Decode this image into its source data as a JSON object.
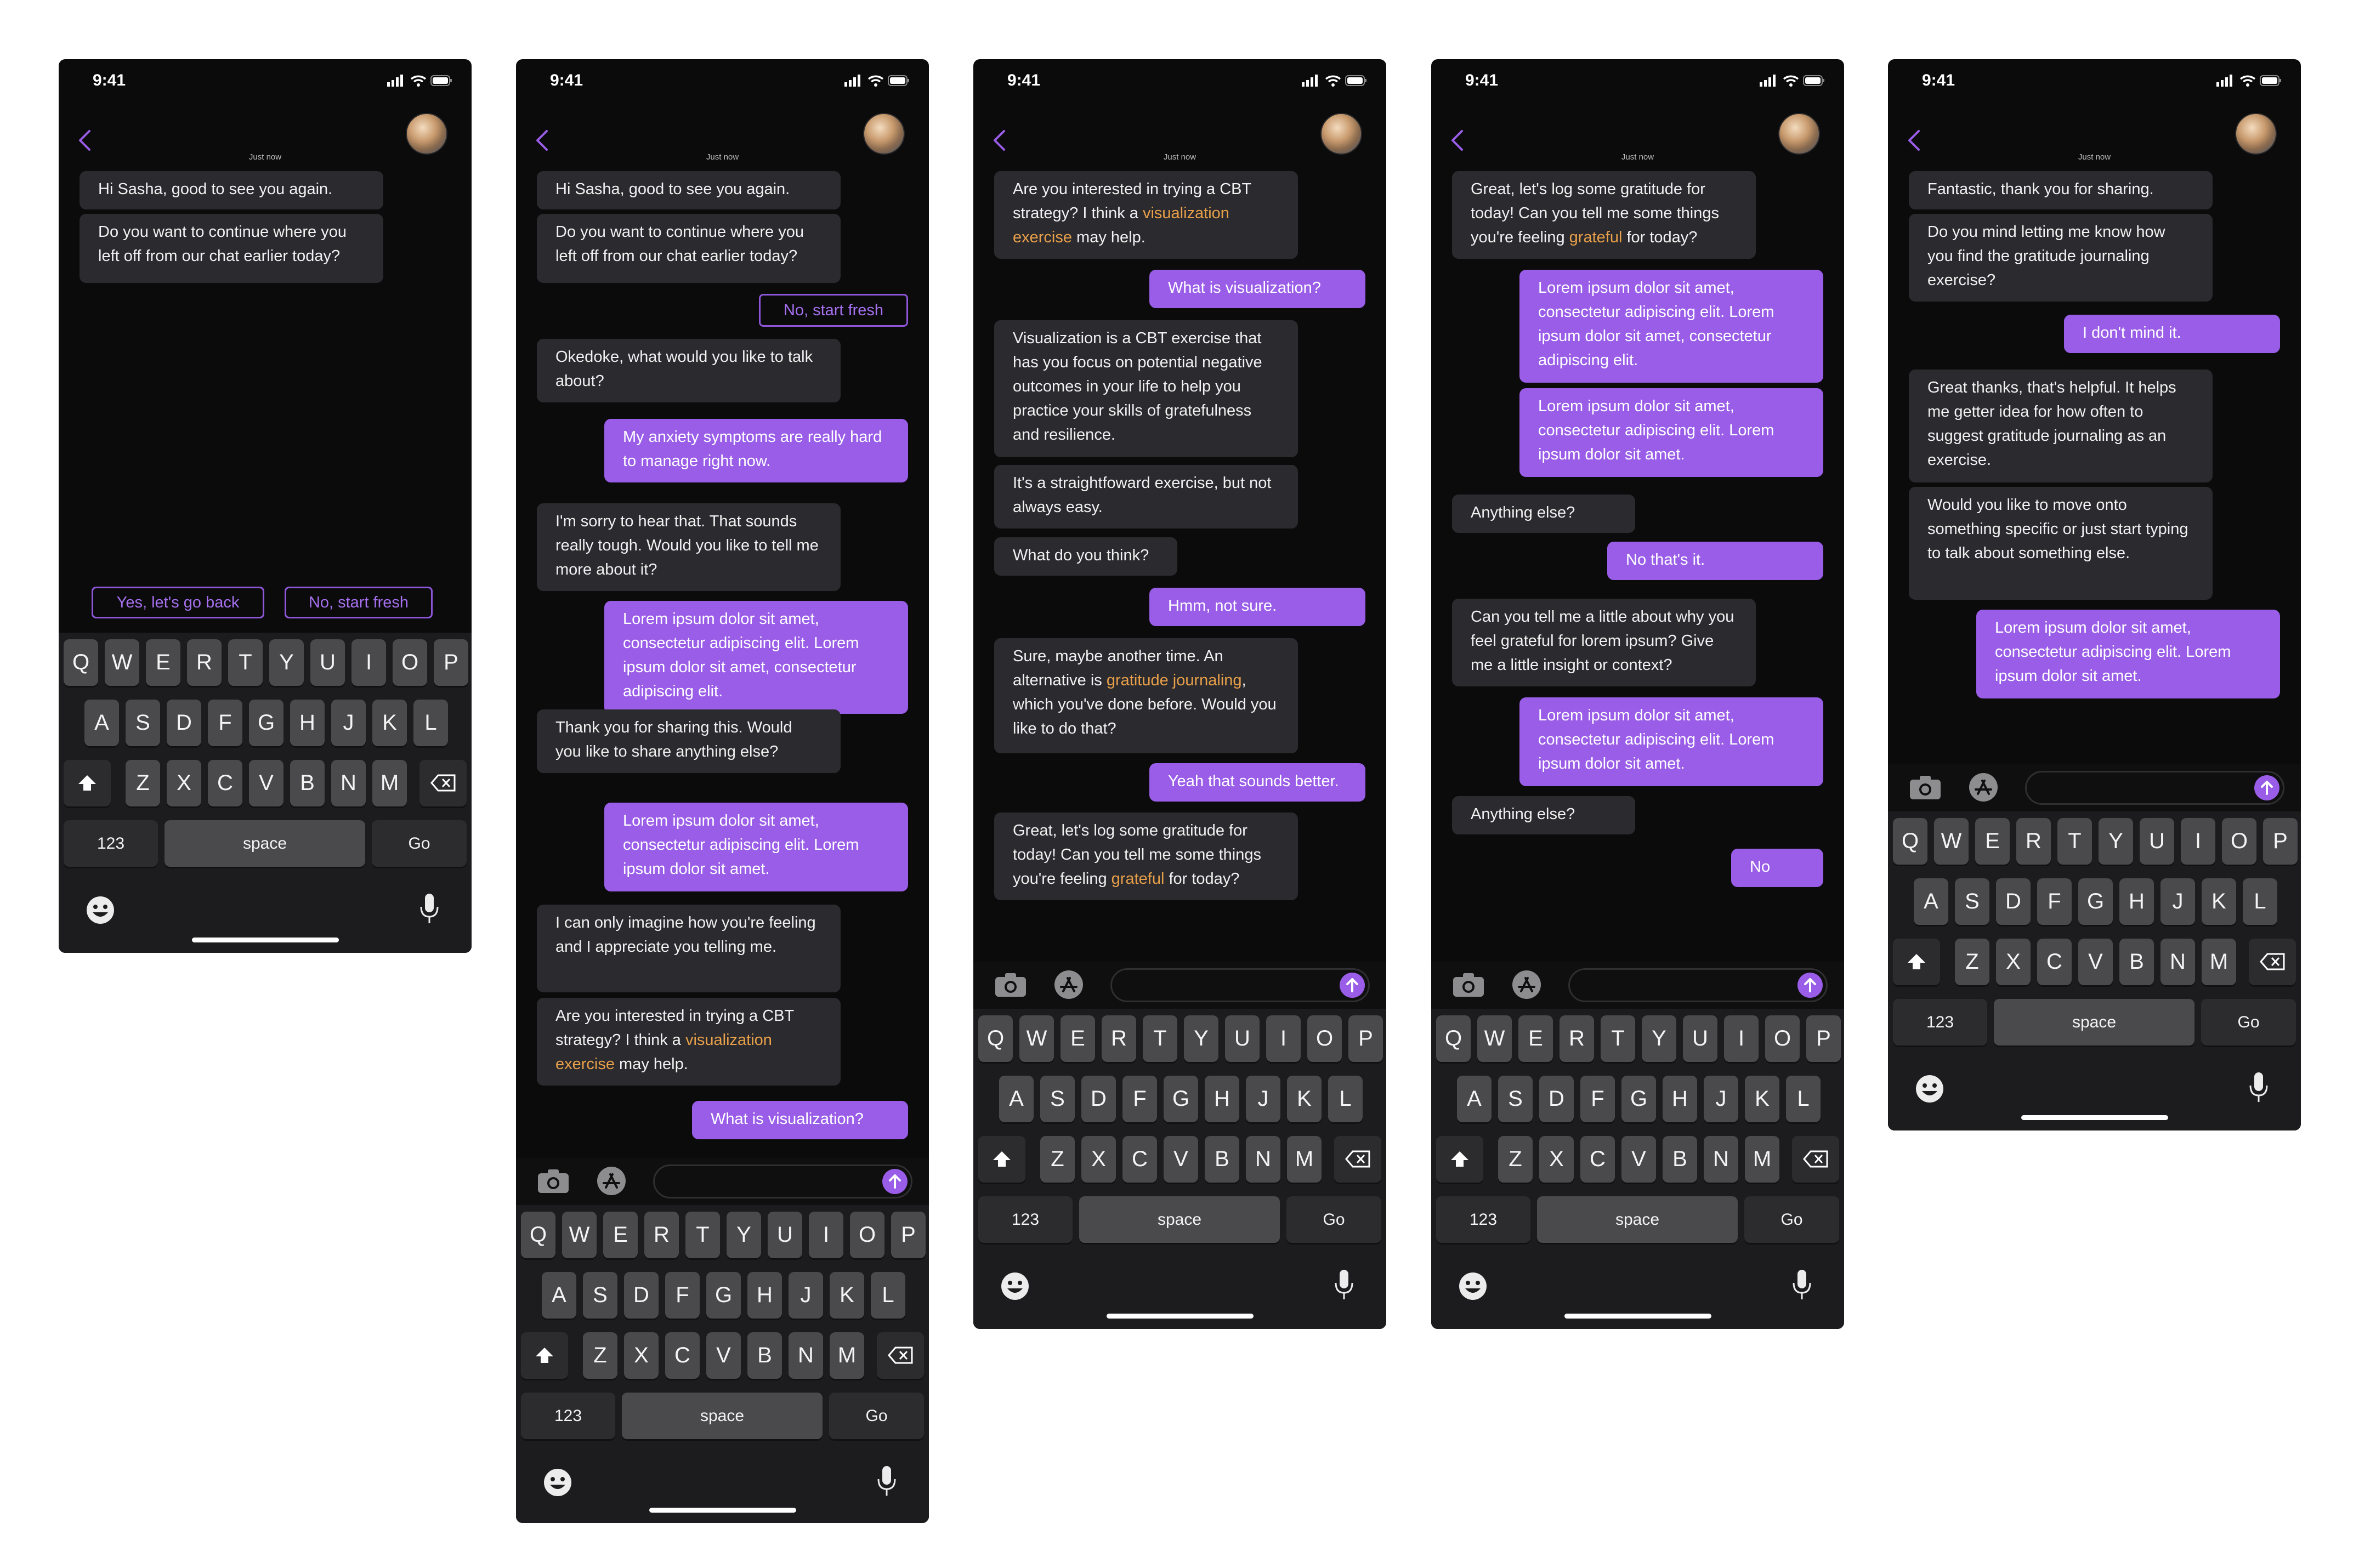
{
  "status": {
    "time": "9:41"
  },
  "timestamp": "Just now",
  "keyboard": {
    "row1": [
      "Q",
      "W",
      "E",
      "R",
      "T",
      "Y",
      "U",
      "I",
      "O",
      "P"
    ],
    "row2": [
      "A",
      "S",
      "D",
      "F",
      "G",
      "H",
      "J",
      "K",
      "L"
    ],
    "row3": [
      "Z",
      "X",
      "C",
      "V",
      "B",
      "N",
      "M"
    ],
    "numbers_label": "123",
    "space_label": "space",
    "go_label": "Go"
  },
  "colors": {
    "accent": "#9a5de8",
    "bot_bubble": "#2b2a2e",
    "highlight": "#e8a04a",
    "background": "#0b0b0c"
  },
  "icons": [
    "back-chevron-icon",
    "avatar",
    "camera-icon",
    "app-store-icon",
    "send-arrow-icon",
    "shift-icon",
    "delete-icon",
    "emoji-icon",
    "microphone-icon",
    "cellular-icon",
    "wifi-icon",
    "battery-icon"
  ],
  "screens": [
    {
      "messages": [
        {
          "from": "bot",
          "text": "Hi Sasha, good to see you again."
        },
        {
          "from": "bot",
          "text": "Do you want to continue where you left off from our chat earlier today?"
        }
      ],
      "quick_replies": [
        "Yes, let's go back",
        "No, start fresh"
      ]
    },
    {
      "messages": [
        {
          "from": "bot",
          "text": "Hi Sasha, good to see you again."
        },
        {
          "from": "bot",
          "text": "Do you want to continue where you left off from our chat earlier today?"
        },
        {
          "from": "choice",
          "text": "No, start fresh"
        },
        {
          "from": "bot",
          "text": "Okedoke, what would you like to talk about?"
        },
        {
          "from": "user",
          "text": "My anxiety symptoms are really hard to manage right now."
        },
        {
          "from": "bot",
          "text": "I'm sorry to hear that. That sounds really tough. Would you like to tell me more about it?"
        },
        {
          "from": "user",
          "text": "Lorem ipsum dolor sit amet, consectetur adipiscing elit. Lorem ipsum dolor sit amet, consectetur adipiscing elit."
        },
        {
          "from": "bot",
          "text": "Thank you for sharing this. Would you like to share anything else?"
        },
        {
          "from": "user",
          "text": "Lorem ipsum dolor sit amet, consectetur adipiscing elit. Lorem ipsum dolor sit amet."
        },
        {
          "from": "bot",
          "text": "I can only imagine how you're feeling and I appreciate you telling me."
        },
        {
          "from": "bot",
          "text": "Are you interested in trying a CBT strategy? I think a ",
          "highlight": "visualization exercise",
          "after": " may help."
        },
        {
          "from": "user",
          "text": "What is visualization?"
        }
      ]
    },
    {
      "messages": [
        {
          "from": "bot",
          "text": "Are you interested in trying a CBT strategy? I think a ",
          "highlight": "visualization exercise",
          "after": " may help."
        },
        {
          "from": "user",
          "text": "What is visualization?"
        },
        {
          "from": "bot",
          "text": "Visualization is a CBT exercise that has you focus on potential negative outcomes in your life to help you practice your skills of gratefulness and resilience."
        },
        {
          "from": "bot",
          "text": "It's a straightfoward exercise, but not always easy."
        },
        {
          "from": "bot",
          "text": "What do you think?"
        },
        {
          "from": "user",
          "text": "Hmm, not sure."
        },
        {
          "from": "bot",
          "text": "Sure, maybe another time. An alternative is ",
          "highlight": "gratitude journaling",
          "after": ", which you've done before. Would you like to do that?"
        },
        {
          "from": "user",
          "text": "Yeah that sounds better."
        },
        {
          "from": "bot",
          "text": "Great, let's log some gratitude for today! Can you tell me some things you're feeling ",
          "highlight": "grateful",
          "after": " for today?"
        }
      ]
    },
    {
      "messages": [
        {
          "from": "bot",
          "text": "Great, let's log some gratitude for today! Can you tell me some things you're feeling ",
          "highlight": "grateful",
          "after": " for today?"
        },
        {
          "from": "user",
          "text": "Lorem ipsum dolor sit amet, consectetur adipiscing elit. Lorem ipsum dolor sit amet, consectetur adipiscing elit."
        },
        {
          "from": "user",
          "text": "Lorem ipsum dolor sit amet, consectetur adipiscing elit. Lorem ipsum dolor sit amet."
        },
        {
          "from": "bot",
          "text": "Anything else?"
        },
        {
          "from": "user",
          "text": "No that's it."
        },
        {
          "from": "bot",
          "text": "Can you tell me a little about why you feel grateful for lorem ipsum? Give me a little insight or context?"
        },
        {
          "from": "user",
          "text": "Lorem ipsum dolor sit amet, consectetur adipiscing elit. Lorem ipsum dolor sit amet."
        },
        {
          "from": "bot",
          "text": "Anything else?"
        },
        {
          "from": "user",
          "text": "No"
        }
      ]
    },
    {
      "messages": [
        {
          "from": "bot",
          "text": "Fantastic, thank you for sharing."
        },
        {
          "from": "bot",
          "text": "Do you mind letting me know how you find the gratitude journaling exercise?"
        },
        {
          "from": "user",
          "text": "I don't mind it."
        },
        {
          "from": "bot",
          "text": "Great thanks, that's helpful. It helps me getter idea for how often to suggest gratitude journaling as an exercise."
        },
        {
          "from": "bot",
          "text": "Would you like to move onto something specific or just start typing to talk about something else."
        },
        {
          "from": "user",
          "text": "Lorem ipsum dolor sit amet, consectetur adipiscing elit. Lorem ipsum dolor sit amet."
        }
      ]
    }
  ]
}
